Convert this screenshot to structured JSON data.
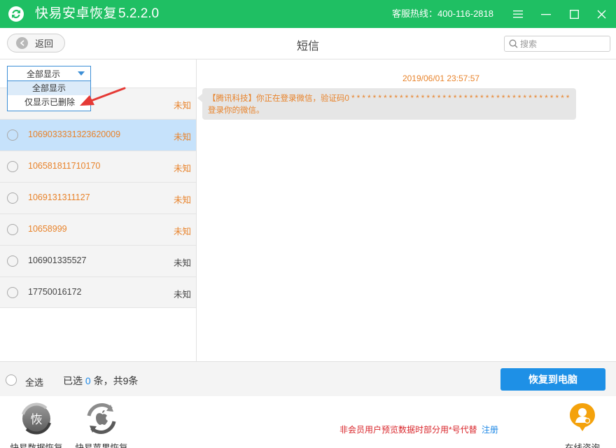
{
  "titlebar": {
    "app_name": "快易安卓恢复",
    "version": "5.2.2.0",
    "hotline": "客服热线：400-116-2818",
    "icons": [
      "menu-icon",
      "minimize-icon",
      "maximize-icon",
      "close-icon"
    ],
    "background": "#1fbf63"
  },
  "header": {
    "back_label": "返回",
    "title": "短信",
    "search_placeholder": "搜索"
  },
  "filter": {
    "selected": "全部显示",
    "options": [
      "全部显示",
      "仅显示已删除"
    ]
  },
  "list": {
    "rows": [
      {
        "number": "",
        "status": "未知"
      },
      {
        "number": "10690333313236200​09",
        "status": "未知"
      },
      {
        "number": "106581811710170",
        "status": "未知"
      },
      {
        "number": "1069131311127",
        "status": "未知"
      },
      {
        "number": "10658999",
        "status": "未知"
      },
      {
        "number": "106901335527",
        "status": "未知"
      },
      {
        "number": "17750016172",
        "status": "未知"
      }
    ]
  },
  "message": {
    "time": "2019/06/01 23:57:57",
    "text": "【腾讯科技】你正在登录微信，验证码0 * * * * * * * * * * * * * * * * * * * * * * * * * * * * * * * * * * * * * * * * *登录你的微信。"
  },
  "selection": {
    "select_all_label": "全选",
    "prefix": "已选",
    "count": "0",
    "suffix": "条，共9条",
    "restore_label": "恢复到电脑"
  },
  "bottom": {
    "tool1_label": "快易数据恢复",
    "tool1_badge": "恢",
    "tool2_label": "快易苹果恢复",
    "promo": "非会员用户预览数据时部分用*号代替",
    "register": "注册",
    "consult_label": "在线咨询"
  },
  "colors": {
    "deleted": "#e8832b",
    "accent": "#1e90e6",
    "selected_row": "#c6e2fb"
  }
}
